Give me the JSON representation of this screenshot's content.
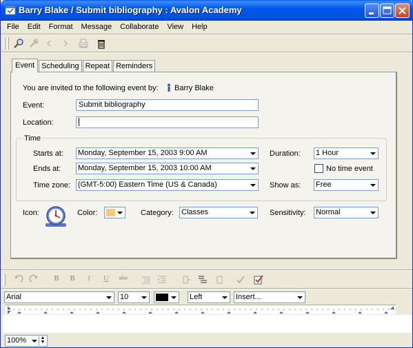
{
  "window": {
    "title": "Barry Blake / Submit bibliography : Avalon Academy",
    "colors": {
      "titlebar": "#0055e5",
      "close_button": "#d9532c",
      "panel_bg": "#f4f3ee",
      "chrome_bg": "#ece9d8"
    }
  },
  "menu": [
    "File",
    "Edit",
    "Format",
    "Message",
    "Collaborate",
    "View",
    "Help"
  ],
  "toolbar": {
    "icons": [
      "search-icon",
      "tools-icon",
      "back-arrow-icon",
      "forward-arrow-icon",
      "print-icon",
      "trash-icon"
    ]
  },
  "tabs": [
    "Event",
    "Scheduling",
    "Repeat",
    "Reminders"
  ],
  "invite": {
    "text": "You are invited to the following event by:",
    "organizer": "Barry Blake"
  },
  "event": {
    "event_label": "Event:",
    "event_value": "Submit bibliography",
    "location_label": "Location:",
    "location_value": ""
  },
  "time": {
    "group_label": "Time",
    "starts_label": "Starts at:",
    "starts_value": "Monday, September 15, 2003 9:00 AM",
    "ends_label": "Ends at:",
    "ends_value": "Monday, September 15, 2003 10:00 AM",
    "tz_label": "Time zone:",
    "tz_value": "(GMT-5:00) Eastern Time (US & Canada)",
    "duration_label": "Duration:",
    "duration_value": "1 Hour",
    "no_time_label": "No time event",
    "show_as_label": "Show as:",
    "show_as_value": "Free"
  },
  "attributes": {
    "icon_label": "Icon:",
    "color_label": "Color:",
    "color_value": "#f9c97a",
    "category_label": "Category:",
    "category_value": "Classes",
    "sensitivity_label": "Sensitivity:",
    "sensitivity_value": "Normal"
  },
  "format": {
    "font": "Arial",
    "size": "10",
    "align": "Left",
    "insert": "Insert..."
  },
  "status": {
    "zoom": "100%"
  }
}
